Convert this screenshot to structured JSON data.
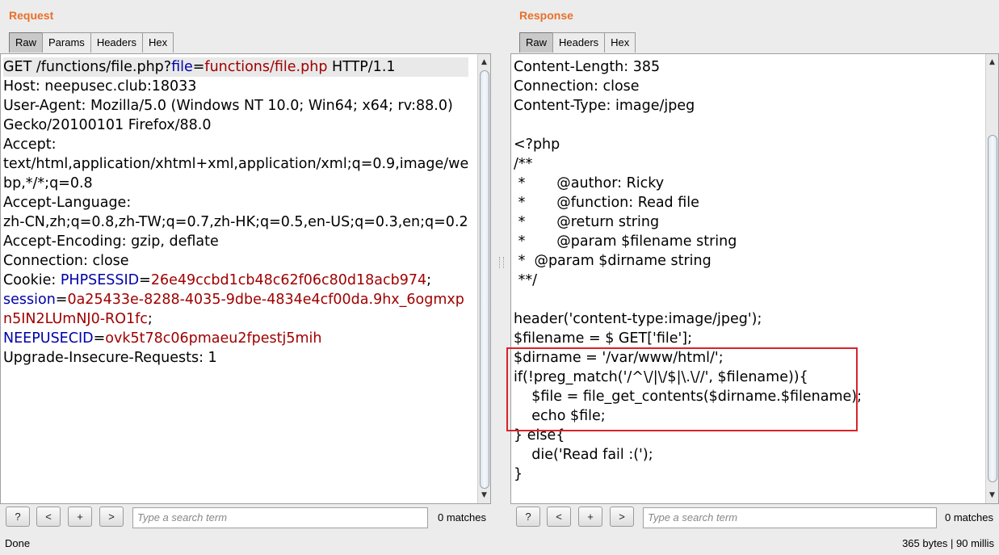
{
  "request": {
    "title": "Request",
    "tabs": [
      "Raw",
      "Params",
      "Headers",
      "Hex"
    ],
    "lines": [
      [
        {
          "t": "GET /functions/file.php?"
        },
        {
          "t": "file",
          "c": "k"
        },
        {
          "t": "="
        },
        {
          "t": "functions/file.php",
          "c": "v"
        },
        {
          "t": " HTTP/1.1"
        }
      ],
      [
        {
          "t": "Host: neepusec.club:18033"
        }
      ],
      [
        {
          "t": "User-Agent: Mozilla/5.0 (Windows NT 10.0; Win64; x64; rv:88.0)"
        }
      ],
      [
        {
          "t": "Gecko/20100101 Firefox/88.0"
        }
      ],
      [
        {
          "t": "Accept:"
        }
      ],
      [
        {
          "t": "text/html,application/xhtml+xml,application/xml;q=0.9,image/we"
        }
      ],
      [
        {
          "t": "bp,*/*;q=0.8"
        }
      ],
      [
        {
          "t": "Accept-Language:"
        }
      ],
      [
        {
          "t": "zh-CN,zh;q=0.8,zh-TW;q=0.7,zh-HK;q=0.5,en-US;q=0.3,en;q=0.2"
        }
      ],
      [
        {
          "t": "Accept-Encoding: gzip, deflate"
        }
      ],
      [
        {
          "t": "Connection: close"
        }
      ],
      [
        {
          "t": "Cookie: "
        },
        {
          "t": "PHPSESSID",
          "c": "k"
        },
        {
          "t": "="
        },
        {
          "t": "26e49ccbd1cb48c62f06c80d18acb974",
          "c": "v"
        },
        {
          "t": ";"
        }
      ],
      [
        {
          "t": "session",
          "c": "k"
        },
        {
          "t": "="
        },
        {
          "t": "0a25433e-8288-4035-9dbe-4834e4cf00da.9hx_6ogmxp",
          "c": "v"
        }
      ],
      [
        {
          "t": "n5IN2LUmNJ0-RO1fc",
          "c": "v"
        },
        {
          "t": ";"
        }
      ],
      [
        {
          "t": "NEEPUSECID",
          "c": "k"
        },
        {
          "t": "="
        },
        {
          "t": "ovk5t78c06pmaeu2fpestj5mih",
          "c": "v"
        }
      ],
      [
        {
          "t": "Upgrade-Insecure-Requests: 1"
        }
      ]
    ],
    "search_placeholder": "Type a search term",
    "matches": "0 matches"
  },
  "response": {
    "title": "Response",
    "tabs": [
      "Raw",
      "Headers",
      "Hex"
    ],
    "lines": [
      [
        {
          "t": "Content-Length: 385"
        }
      ],
      [
        {
          "t": "Connection: close"
        }
      ],
      [
        {
          "t": "Content-Type: image/jpeg"
        }
      ],
      [
        {
          "t": ""
        }
      ],
      [
        {
          "t": "<?php"
        }
      ],
      [
        {
          "t": "/**"
        }
      ],
      [
        {
          "t": " *       @author: Ricky"
        }
      ],
      [
        {
          "t": " *       @function: Read file"
        }
      ],
      [
        {
          "t": " *       @return string"
        }
      ],
      [
        {
          "t": " *       @param $filename string"
        }
      ],
      [
        {
          "t": " *  @param $dirname string"
        }
      ],
      [
        {
          "t": " **/"
        }
      ],
      [
        {
          "t": ""
        }
      ],
      [
        {
          "t": "header('content-type:image/jpeg');"
        }
      ],
      [
        {
          "t": "$filename = $ GET['file'];"
        }
      ],
      [
        {
          "t": "$dirname = '/var/www/html/';"
        }
      ],
      [
        {
          "t": "if(!preg_match('/^\\/|\\/$|\\.\\//', $filename)){"
        }
      ],
      [
        {
          "t": "    $file = file_get_contents($dirname.$filename);"
        }
      ],
      [
        {
          "t": "    echo $file;"
        }
      ],
      [
        {
          "t": "} else{"
        }
      ],
      [
        {
          "t": "    die('Read fail :(');"
        }
      ],
      [
        {
          "t": "}"
        }
      ]
    ],
    "search_placeholder": "Type a search term",
    "matches": "0 matches"
  },
  "buttons": {
    "help": "?",
    "prev": "<",
    "add": "+",
    "next": ">"
  },
  "status": {
    "left": "Done",
    "right": "365 bytes | 90 millis"
  }
}
